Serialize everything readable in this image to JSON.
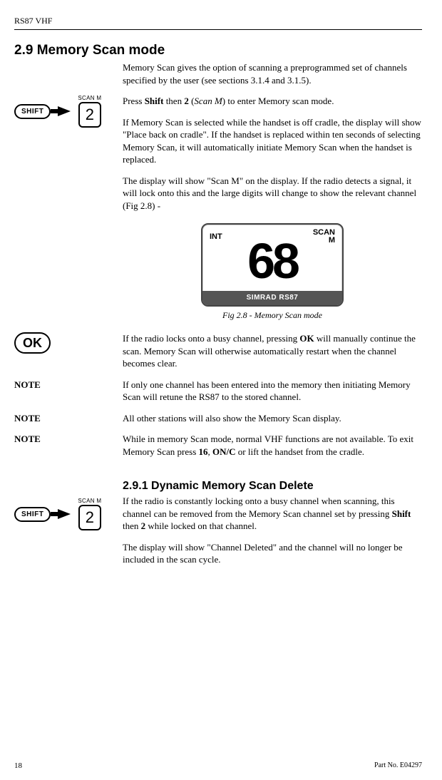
{
  "header": "RS87 VHF",
  "section": {
    "num_title": "2.9  Memory Scan mode",
    "p1": "Memory Scan gives the option of scanning a preprogrammed set of channels specified by the user (see sections 3.1.4 and 3.1.5).",
    "p2_pre": "Press ",
    "p2_b1": "Shift",
    "p2_mid": " then ",
    "p2_b2": "2",
    "p2_par": " (",
    "p2_i": "Scan M",
    "p2_post": ") to enter Memory scan mode.",
    "p3": "If Memory Scan is selected while the handset is off cradle, the display will show \"Place back on cradle\".  If the handset is replaced within ten seconds of selecting Memory Scan, it will automatically initiate Memory Scan when the handset is replaced.",
    "p4": "The display will show \"Scan M\" on the display.  If the radio detects a signal, it will lock onto this and the large digits will change to show the relevant channel (Fig 2.8) -"
  },
  "lcd": {
    "left": "INT",
    "right_top": "SCAN",
    "right_bot": "M",
    "digits": "68",
    "brand": "SIMRAD RS87"
  },
  "caption": "Fig 2.8 - Memory Scan mode",
  "ok": {
    "pre": "If the radio locks onto a busy channel, pressing ",
    "b": "OK",
    "post": " will manu­ally continue the scan.  Memory Scan will otherwise automati­cally restart when the channel becomes clear."
  },
  "notes": {
    "label": "NOTE",
    "n1": "If only one channel has been entered into the memory then initiating Memory Scan will retune the RS87 to the stored channel.",
    "n2": "All other stations will also show the Memory Scan display.",
    "n3_pre": "While in memory Scan mode, normal VHF functions are not available.  To exit Memory Scan press ",
    "n3_b1": "16",
    "n3_mid": ", ",
    "n3_b2": "ON/C",
    "n3_post": " or lift the handset from the cradle."
  },
  "sub": {
    "title": "2.9.1  Dynamic Memory Scan Delete",
    "p1_pre": "If the radio is constantly locking onto a busy channel when scanning, this channel can be removed from the Memory Scan channel set by pressing ",
    "p1_b1": "Shift",
    "p1_mid": " then ",
    "p1_b2": "2",
    "p1_post": " while locked on that channel.",
    "p2": "The display will show \"Channel Deleted\" and the channel will no longer be included in the scan cycle."
  },
  "keys": {
    "shift": "SHIFT",
    "scanm": "SCAN M",
    "two": "2",
    "ok": "OK"
  },
  "footer": {
    "page": "18",
    "part": "Part No. E04297"
  }
}
